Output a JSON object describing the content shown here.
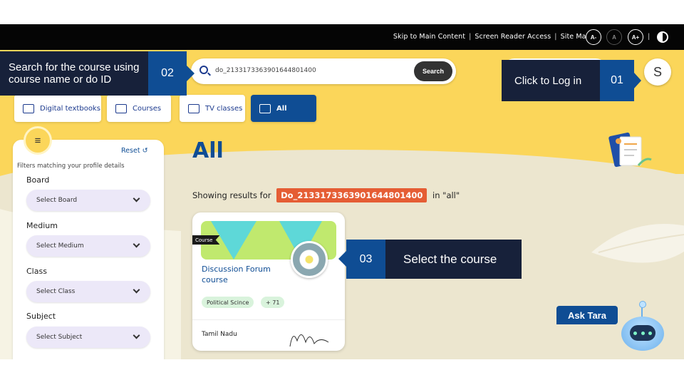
{
  "topbar": {
    "skip": "Skip to Main Content",
    "screen_reader": "Screen Reader Access",
    "site_map": "Site Map",
    "font_decrease": "A-",
    "font_normal": "A",
    "font_increase": "A+"
  },
  "search": {
    "value": "do_2133173363901644801400",
    "button": "Search"
  },
  "user": {
    "initial": "S"
  },
  "callouts": {
    "c02": {
      "text": "Search for the course using course name or do ID",
      "num": "02"
    },
    "c01": {
      "text": "Click to Log in",
      "num": "01"
    },
    "c03": {
      "num": "03",
      "text": "Select the course"
    }
  },
  "tabs": [
    {
      "label": "Digital textbooks",
      "icon": "book-icon"
    },
    {
      "label": "Courses",
      "icon": "graduation-cap-icon"
    },
    {
      "label": "TV classes",
      "icon": "tv-icon"
    },
    {
      "label": "All",
      "icon": "inbox-icon"
    }
  ],
  "page_title": "All",
  "filters": {
    "reset": "Reset",
    "message": "Filters matching your profile details",
    "board_label": "Board",
    "board_placeholder": "Select Board",
    "medium_label": "Medium",
    "medium_placeholder": "Select Medium",
    "class_label": "Class",
    "class_placeholder": "Select Class",
    "subject_label": "Subject",
    "subject_placeholder": "Select Subject"
  },
  "results": {
    "prefix": "Showing results for",
    "query": "Do_2133173363901644801400",
    "suffix": "in \"all\""
  },
  "card": {
    "badge": "Course",
    "title": "Discussion Forum course",
    "subject_chip": "Political Scince",
    "more_chip": "+ 71",
    "board": "Tamil Nadu"
  },
  "ask_tara": "Ask Tara",
  "colors": {
    "brand_blue": "#0f4d94",
    "yellow": "#fbd65a",
    "highlight": "#e55d34"
  }
}
